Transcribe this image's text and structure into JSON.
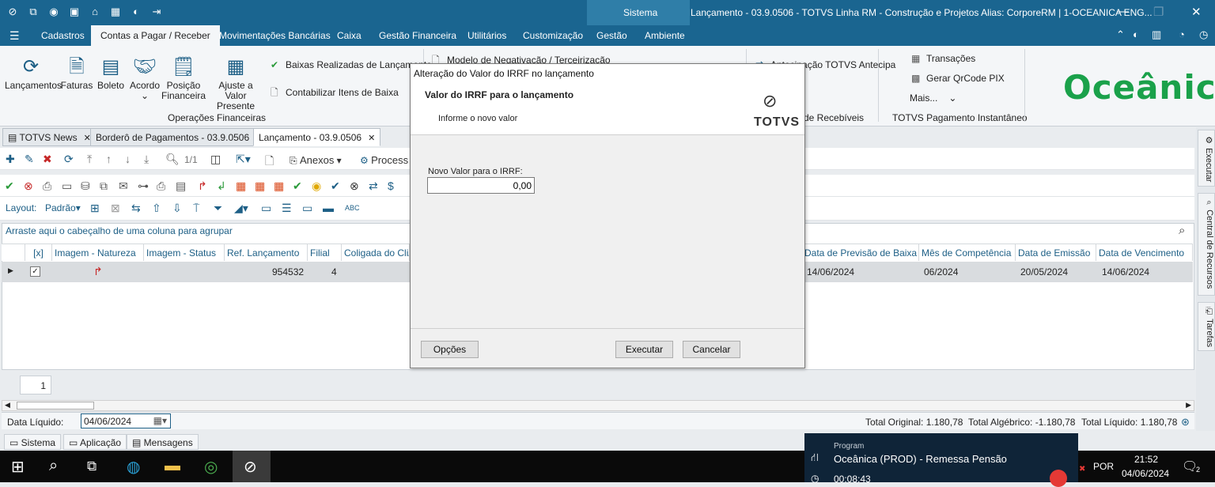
{
  "window": {
    "title": "Lançamento - 03.9.0506 - TOTVS Linha RM - Construção e Projetos  Alias: CorporeRM | 1-OCEANICA ENG...",
    "sistema_label": "Sistema"
  },
  "menu": {
    "items": [
      "Cadastros",
      "Contas a Pagar / Receber",
      "Movimentações Bancárias",
      "Caixa",
      "Gestão Financeira",
      "Utilitários",
      "Customização",
      "Gestão",
      "Ambiente"
    ]
  },
  "ribbon": {
    "buttons": [
      {
        "label": "Lançamentos",
        "icon": "refresh-money-icon"
      },
      {
        "label": "Faturas",
        "icon": "document-icon"
      },
      {
        "label": "Boleto",
        "icon": "barcode-icon"
      },
      {
        "label": "Acordo",
        "icon": "handshake-icon"
      },
      {
        "label": "Posição Financeira",
        "icon": "report-clock-icon"
      },
      {
        "label": "Ajuste a Valor Presente",
        "icon": "calculator-icon"
      }
    ],
    "small_items": [
      "Baixas Realizadas de Lançamento",
      "Contabilizar Itens de Baixa",
      "Modelo de Negativação / Terceirização",
      "Antecipação TOTVS Antecipa",
      "de Recebíveis",
      "Transações",
      "Gerar QrCode PIX",
      "Mais..."
    ],
    "groups": [
      "Operações Financeiras",
      "TOTVS Pagamento Instantâneo"
    ],
    "logo": "Oceânica"
  },
  "doc_tabs": [
    {
      "label": "TOTVS News"
    },
    {
      "label": "Borderô de Pagamentos - 03.9.0506"
    },
    {
      "label": "Lançamento - 03.9.0506"
    }
  ],
  "toolbar": {
    "record_counter": "1/1",
    "anexos": "Anexos",
    "processos": "Process",
    "layout_label": "Layout:",
    "layout_value": "Padrão"
  },
  "grid": {
    "group_hint": "Arraste aqui o cabeçalho de uma coluna para agrupar",
    "columns": [
      "[x]",
      "Imagem - Natureza",
      "Imagem - Status",
      "Ref. Lançamento",
      "Filial",
      "Coligada do Cli/Fo",
      "Data de Previsão de Baixa",
      "Mês de Competência",
      "Data de Emissão",
      "Data de Vencimento"
    ],
    "row": {
      "ref": "954532",
      "filial": "4",
      "data_prev_baixa": "14/06/2024",
      "mes_competencia": "06/2024",
      "data_emissao": "20/05/2024",
      "data_vencimento": "14/06/2024"
    },
    "page": "1"
  },
  "status": {
    "data_liquido_label": "Data Líquido:",
    "data_liquido_value": "04/06/2024",
    "total_original": "Total Original: 1.180,78",
    "total_algebrico": "Total Algébrico: -1.180,78",
    "total_liquido": "Total Líquido: 1.180,78"
  },
  "sidebar_tabs": [
    "Executar",
    "Central de Recursos",
    "Tarefas"
  ],
  "bottom_tabs": [
    "Sistema",
    "Aplicação",
    "Mensagens"
  ],
  "modal": {
    "title": "Alteração do Valor do IRRF no lançamento",
    "heading": "Valor do IRRF para o lançamento",
    "subheading": "Informe o novo valor",
    "brand": "TOTVS",
    "field_label": "Novo Valor para o IRRF:",
    "field_value": "0,00",
    "options_button": "Opções",
    "execute_button": "Executar",
    "cancel_button": "Cancelar"
  },
  "notification": {
    "caption": "Program",
    "title": "Oceânica (PROD) - Remessa Pensão",
    "time": "00:08:43"
  },
  "taskbar": {
    "language": "POR",
    "time": "21:52",
    "date": "04/06/2024",
    "notif_count": "2"
  },
  "colors": {
    "titlebar": "#1a6590",
    "accent": "#1d5f86",
    "logo": "#1aa14a"
  }
}
